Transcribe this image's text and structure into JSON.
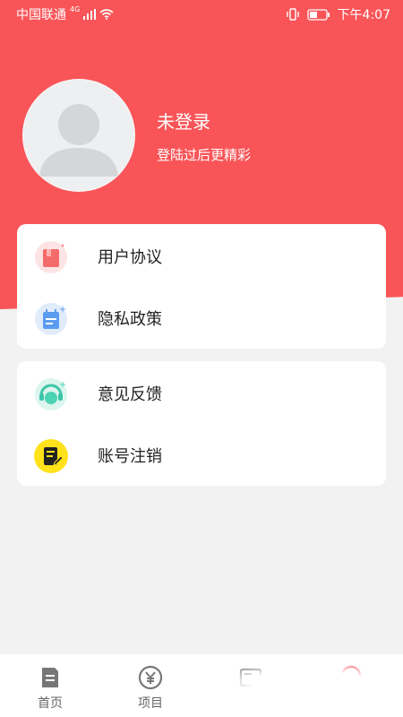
{
  "status": {
    "carrier": "中国联通",
    "network": "4G",
    "time": "下午4:07"
  },
  "profile": {
    "name": "未登录",
    "subtitle": "登陆过后更精彩"
  },
  "menu_group_1": [
    {
      "label": "用户协议",
      "icon": "user-agreement-icon"
    },
    {
      "label": "隐私政策",
      "icon": "privacy-policy-icon"
    }
  ],
  "menu_group_2": [
    {
      "label": "意见反馈",
      "icon": "feedback-icon"
    },
    {
      "label": "账号注销",
      "icon": "account-cancel-icon"
    }
  ],
  "tabs": [
    {
      "label": "首页",
      "icon": "home-doc-icon"
    },
    {
      "label": "项目",
      "icon": "yen-icon"
    }
  ],
  "colors": {
    "brand": "#f95558",
    "background": "#f2f2f2"
  }
}
